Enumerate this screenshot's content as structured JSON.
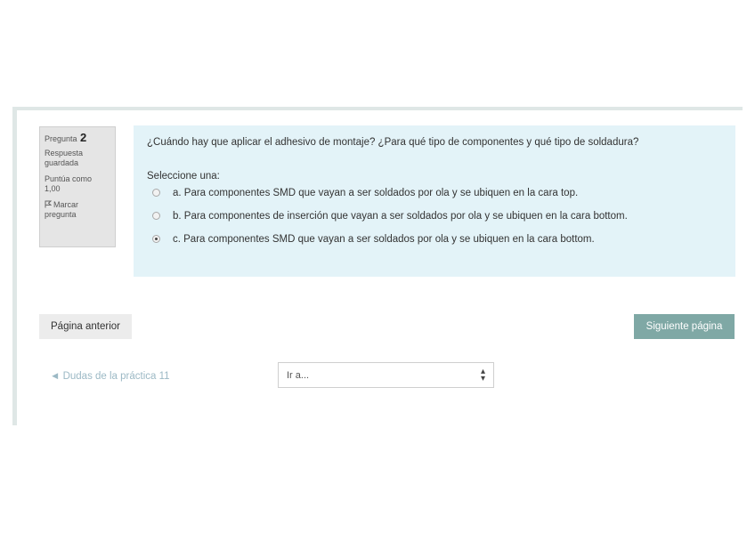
{
  "question_info": {
    "label": "Pregunta",
    "number": "2",
    "state_line1": "Respuesta",
    "state_line2": "guardada",
    "grade_line1": "Puntúa como",
    "grade_line2": "1,00",
    "flag_line1": "Marcar",
    "flag_line2": "pregunta"
  },
  "question": {
    "text": "¿Cuándo hay que aplicar el adhesivo de montaje? ¿Para qué tipo de componentes y qué tipo de soldadura?",
    "prompt": "Seleccione una:",
    "options": [
      {
        "label": "a. Para componentes SMD que vayan a ser soldados por ola y se ubiquen en la cara top.",
        "selected": false
      },
      {
        "label": "b. Para componentes de inserción que vayan a ser soldados por ola y se ubiquen en la cara bottom.",
        "selected": false
      },
      {
        "label": "c. Para componentes SMD que vayan a ser soldados por ola y se ubiquen en la cara bottom.",
        "selected": true
      }
    ]
  },
  "navigation": {
    "prev_label": "Página anterior",
    "next_label": "Siguiente página",
    "prev_activity": "◄ Dudas de la práctica 11",
    "jump_value": "Ir a...",
    "next_color": "#7fa8a5"
  }
}
